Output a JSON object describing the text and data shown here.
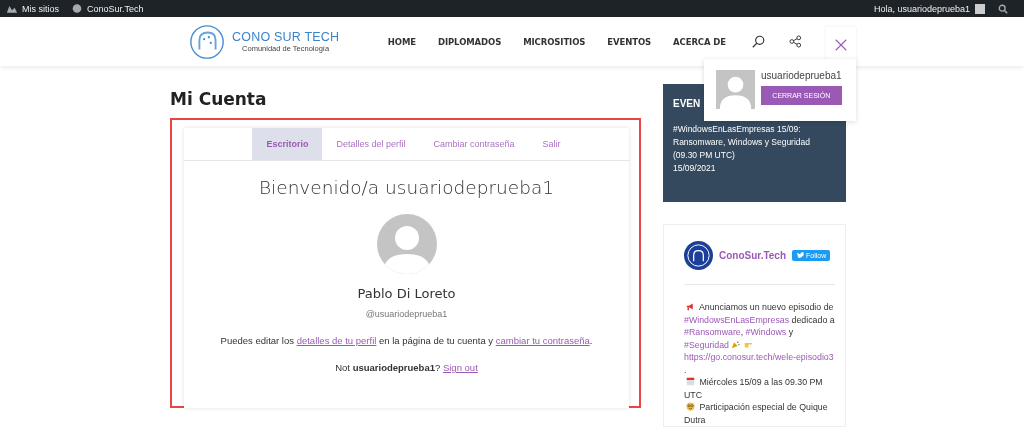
{
  "admin_bar": {
    "items": [
      "Mis sitios",
      "ConoSur.Tech"
    ],
    "greeting": "Hola, usuariodeprueba1"
  },
  "header": {
    "logo_title": "CONO SUR TECH",
    "logo_subtitle": "Comunidad de Tecnología",
    "nav": [
      "HOME",
      "DIPLOMADOS",
      "MICROSITIOS",
      "EVENTOS",
      "ACERCA DE"
    ]
  },
  "user_menu": {
    "username": "usuariodeprueba1",
    "button": "CERRAR SESIÓN"
  },
  "page_title": "Mi Cuenta",
  "account": {
    "tabs": [
      {
        "label": "Escritorio",
        "selected": true
      },
      {
        "label": "Detalles del perfil",
        "selected": false
      },
      {
        "label": "Cambiar contraseña",
        "selected": false
      },
      {
        "label": "Salir",
        "selected": false
      }
    ],
    "welcome": "Bienvenido/a usuariodeprueba1",
    "name": "Pablo Di Loreto",
    "handle": "@usuariodeprueba1",
    "info": [
      {
        "kind": "text",
        "text": "Puedes editar los "
      },
      {
        "kind": "link",
        "text": "detalles de tu perfil"
      },
      {
        "kind": "text",
        "text": " en la página de tu cuenta y "
      },
      {
        "kind": "link",
        "text": "cambiar tu contraseña"
      },
      {
        "kind": "text",
        "text": "."
      }
    ],
    "signout": [
      {
        "kind": "text",
        "text": "Not "
      },
      {
        "kind": "bold",
        "text": "usuariodeprueba1"
      },
      {
        "kind": "text",
        "text": "? "
      },
      {
        "kind": "link",
        "text": "Sign out"
      }
    ]
  },
  "events": {
    "title": "EVEN",
    "lines": [
      "#WindowsEnLasEmpresas 15/09: Ransomware, Windows y Seguridad (09.30 PM UTC)",
      "15/09/2021"
    ]
  },
  "twitter": {
    "account": "ConoSur.Tech",
    "follow": "Follow",
    "lines": [
      [
        {
          "kind": "megaphone"
        },
        {
          "kind": "text",
          "text": " Anunciamos un nuevo episodio de "
        },
        {
          "kind": "link",
          "text": "#WindowsEnLasEmpresas"
        },
        {
          "kind": "text",
          "text": " dedicado a "
        },
        {
          "kind": "link",
          "text": "#Ransomware"
        },
        {
          "kind": "text",
          "text": ", "
        },
        {
          "kind": "link",
          "text": "#Windows"
        },
        {
          "kind": "text",
          "text": " y "
        },
        {
          "kind": "link",
          "text": "#Seguridad"
        },
        {
          "kind": "party"
        },
        {
          "kind": "pointing"
        },
        {
          "kind": "link",
          "text": "https://go.conosur.tech/wele-episodio3"
        }
      ],
      [
        {
          "kind": "text",
          "text": "."
        }
      ],
      [
        {
          "kind": "calendar"
        },
        {
          "kind": "text",
          "text": " Miércoles 15/09 a las 09.30 PM UTC"
        }
      ],
      [
        {
          "kind": "nerd"
        },
        {
          "kind": "text",
          "text": " Participación especial de Quique Dutra"
        }
      ]
    ]
  }
}
